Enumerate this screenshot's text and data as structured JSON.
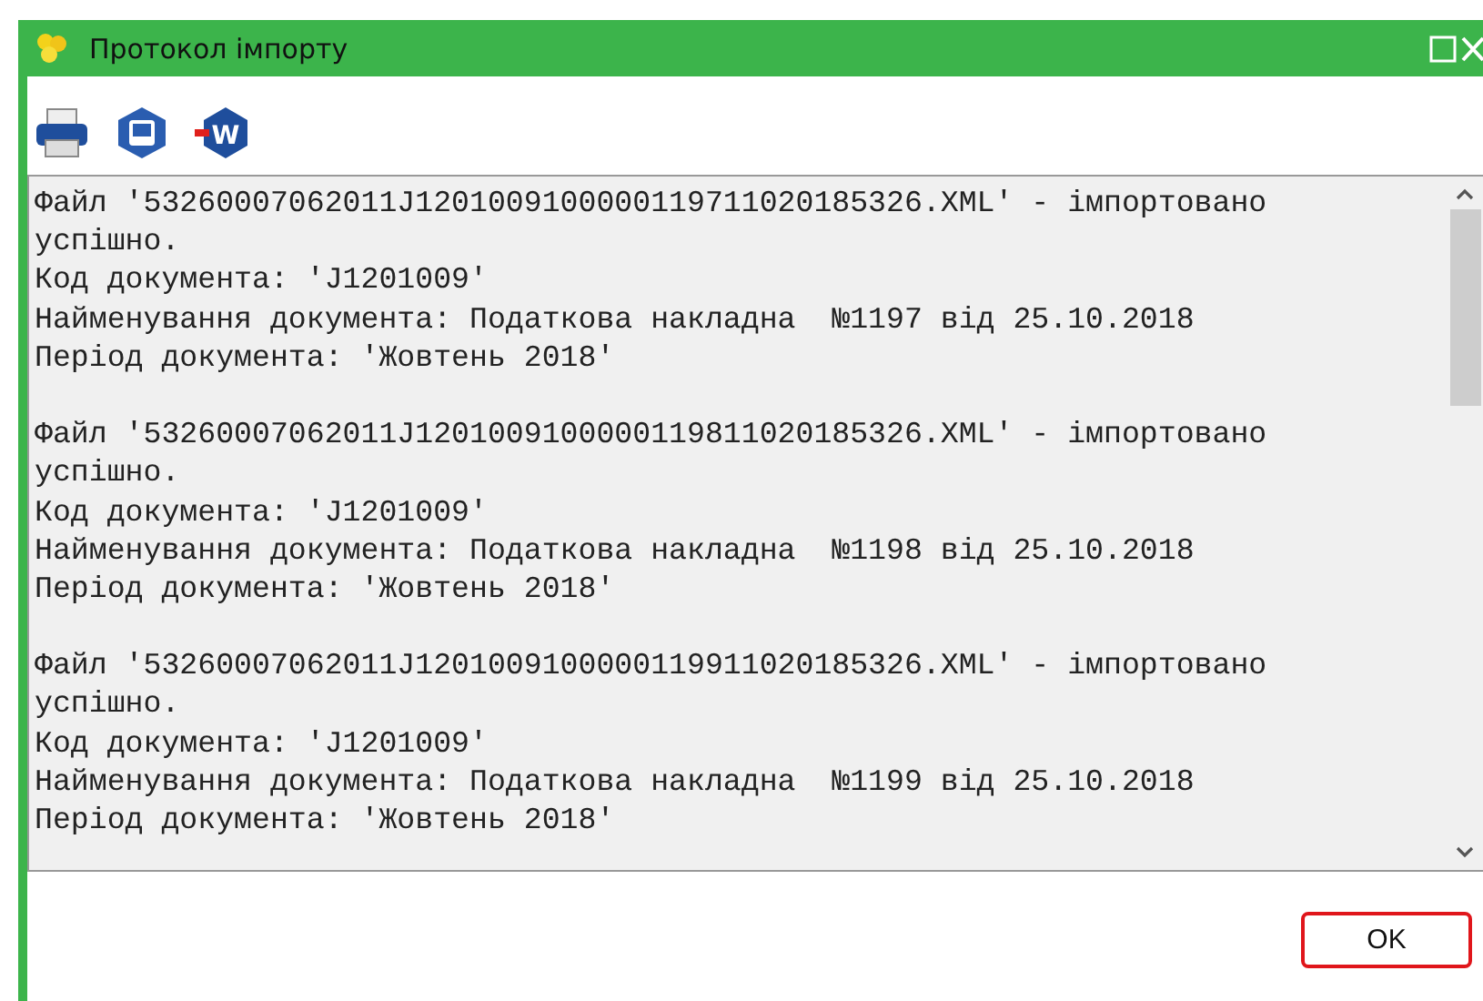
{
  "window": {
    "title": "Протокол імпорту"
  },
  "toolbar": [
    {
      "kind": "print"
    },
    {
      "kind": "save"
    },
    {
      "kind": "word",
      "glyph": "W"
    }
  ],
  "log": [
    {
      "lines": [
        "Файл '53260007062011J1201009100000119711020185326.XML' - імпортовано",
        "успішно.",
        "Код документа: 'J1201009'",
        "Найменування документа: Податкова накладна  №1197 від 25.10.2018",
        "Період документа: 'Жовтень 2018'"
      ]
    },
    {
      "lines": [
        "Файл '53260007062011J1201009100000119811020185326.XML' - імпортовано",
        "успішно.",
        "Код документа: 'J1201009'",
        "Найменування документа: Податкова накладна  №1198 від 25.10.2018",
        "Період документа: 'Жовтень 2018'"
      ]
    },
    {
      "lines": [
        "Файл '53260007062011J1201009100000119911020185326.XML' - імпортовано",
        "успішно.",
        "Код документа: 'J1201009'",
        "Найменування документа: Податкова накладна  №1199 від 25.10.2018",
        "Період документа: 'Жовтень 2018'"
      ]
    }
  ],
  "buttons": [
    {
      "label": "OK",
      "focused": true
    }
  ]
}
